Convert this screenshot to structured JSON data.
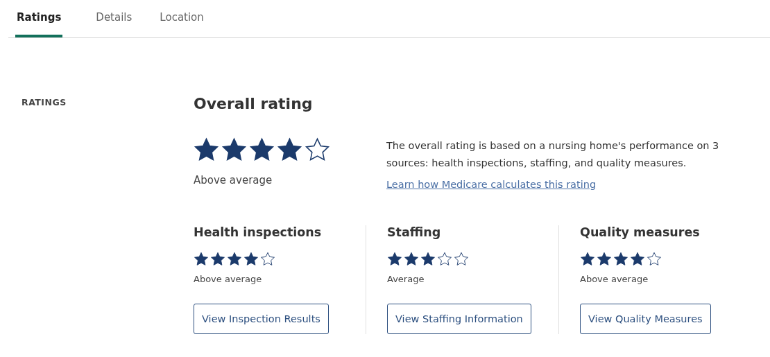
{
  "tabs": [
    {
      "label": "Ratings",
      "selected": true
    },
    {
      "label": "Details",
      "selected": false
    },
    {
      "label": "Location",
      "selected": false
    }
  ],
  "section_label": "RATINGS",
  "overall": {
    "title": "Overall rating",
    "stars": 4,
    "rating_text": "Above average",
    "description": "The overall rating is based on a nursing home's performance on 3 sources: health inspections, staffing, and quality measures.",
    "link": "Learn how Medicare calculates this rating"
  },
  "categories": [
    {
      "title": "Health inspections",
      "stars": 4,
      "rating_text": "Above average",
      "button": "View Inspection Results"
    },
    {
      "title": "Staffing",
      "stars": 3,
      "rating_text": "Average",
      "button": "View Staffing Information"
    },
    {
      "title": "Quality measures",
      "stars": 4,
      "rating_text": "Above average",
      "button": "View Quality Measures"
    }
  ]
}
